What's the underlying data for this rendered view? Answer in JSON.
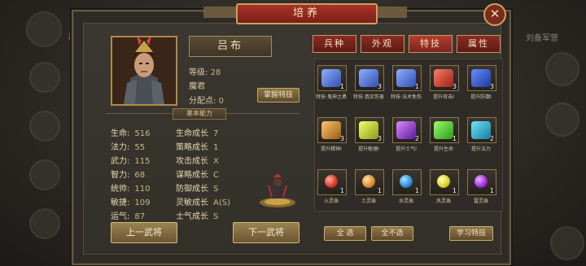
{
  "window": {
    "title": "培养",
    "close_icon": "close-icon"
  },
  "background": {
    "right_label": "刘备军营",
    "left_label": "副将"
  },
  "hero": {
    "name": "吕布",
    "level_label": "等级:",
    "level_value": "28",
    "title": "魔君",
    "points_label": "分配点:",
    "points_value": "0",
    "master_button": "掌握特技"
  },
  "section": {
    "basic_ability": "基本能力"
  },
  "stats": [
    {
      "label": "生命:",
      "value": "516"
    },
    {
      "label": "法力:",
      "value": "55"
    },
    {
      "label": "武力:",
      "value": "115"
    },
    {
      "label": "智力:",
      "value": "68"
    },
    {
      "label": "统帅:",
      "value": "110"
    },
    {
      "label": "敏捷:",
      "value": "109"
    },
    {
      "label": "运气:",
      "value": "87"
    }
  ],
  "growth": [
    {
      "label": "生命成长",
      "value": "7"
    },
    {
      "label": "策略成长",
      "value": "1"
    },
    {
      "label": "攻击成长",
      "value": "X"
    },
    {
      "label": "谋略成长",
      "value": "C"
    },
    {
      "label": "防御成长",
      "value": "S"
    },
    {
      "label": "灵敏成长",
      "value": "A(S)"
    },
    {
      "label": "士气成长",
      "value": "S"
    }
  ],
  "tabs": [
    {
      "label": "兵种"
    },
    {
      "label": "外观"
    },
    {
      "label": "特技"
    },
    {
      "label": "属性"
    }
  ],
  "items": [
    {
      "label": "特技·鬼神之勇",
      "count": "1",
      "color": "#3d63c9",
      "icon": "scroll-icon"
    },
    {
      "label": "特技·真实伤害",
      "count": "3",
      "color": "#3d63c9",
      "icon": "scroll-icon"
    },
    {
      "label": "特技·法术免伤",
      "count": "1",
      "color": "#3d63c9",
      "icon": "scroll-icon"
    },
    {
      "label": "提升攻击I",
      "count": "3",
      "color": "#c83a2e",
      "icon": "book-icon"
    },
    {
      "label": "提升防御I",
      "count": "3",
      "color": "#2f58c8",
      "icon": "book-icon"
    },
    {
      "label": "提升精神I",
      "count": "3",
      "color": "#d99a2b",
      "icon": "book-icon"
    },
    {
      "label": "提升敏捷I",
      "count": "3",
      "color": "#c8d33a",
      "icon": "book-icon"
    },
    {
      "label": "提升士气I",
      "count": "2",
      "color": "#a03ac8",
      "icon": "book-icon"
    },
    {
      "label": "提升生命",
      "count": "1",
      "color": "#5fd33a",
      "icon": "book-icon"
    },
    {
      "label": "提升法力",
      "count": "2",
      "color": "#3ab8d3",
      "icon": "book-icon"
    },
    {
      "label": "火灵珠",
      "count": "1",
      "color": "#d9332a",
      "icon": "orb-icon"
    },
    {
      "label": "土灵珠",
      "count": "1",
      "color": "#d98a2a",
      "icon": "orb-icon"
    },
    {
      "label": "水灵珠",
      "count": "1",
      "color": "#2a8ad9",
      "icon": "orb-icon"
    },
    {
      "label": "风灵珠",
      "count": "1",
      "color": "#d9d32a",
      "icon": "orb-icon"
    },
    {
      "label": "雷灵珠",
      "count": "1",
      "color": "#a52ad9",
      "icon": "orb-icon"
    }
  ],
  "buttons": {
    "prev": "上一武将",
    "next": "下一武将",
    "select_all": "全 选",
    "deselect_all": "全不选",
    "learn": "学习特技"
  }
}
